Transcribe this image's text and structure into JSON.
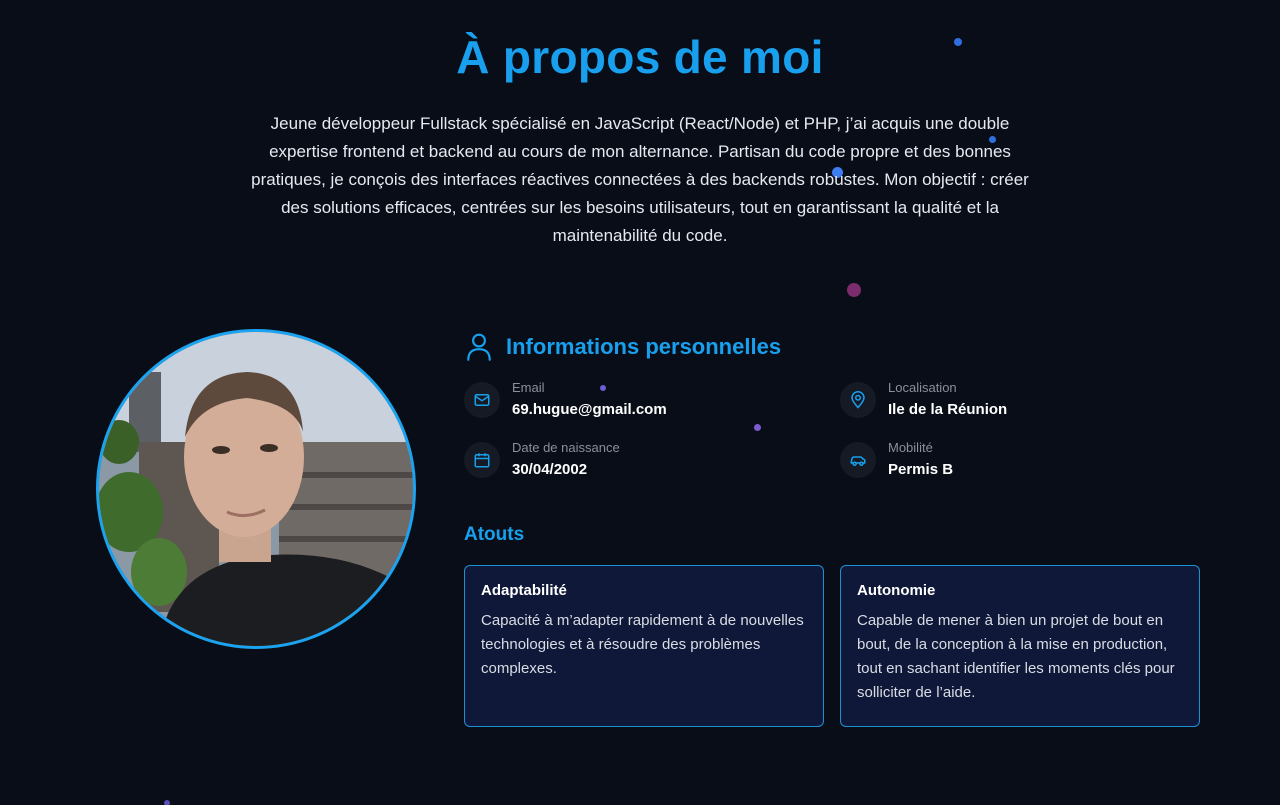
{
  "about": {
    "title": "À propos de moi",
    "intro": "Jeune développeur Fullstack spécialisé en JavaScript (React/Node) et PHP, j’ai acquis une double expertise frontend et backend au cours de mon alternance. Partisan du code propre et des bonnes pratiques, je conçois des interfaces réactives connectées à des backends robustes. Mon objectif : créer des solutions efficaces, centrées sur les besoins utilisateurs, tout en garantissant la qualité et la maintenabilité du code."
  },
  "personal_info": {
    "title": "Informations personnelles",
    "title_icon": "user-icon",
    "items": [
      {
        "label": "Email",
        "value": "69.hugue@gmail.com",
        "icon": "mail-icon"
      },
      {
        "label": "Localisation",
        "value": "Ile de la Réunion",
        "icon": "map-pin-icon"
      },
      {
        "label": "Date de naissance",
        "value": "30/04/2002",
        "icon": "calendar-icon"
      },
      {
        "label": "Mobilité",
        "value": "Permis B",
        "icon": "car-icon"
      }
    ]
  },
  "atouts": {
    "title": "Atouts",
    "cards": [
      {
        "title": "Adaptabilité",
        "text": "Capacité à m’adapter rapidement à de nouvelles technologies et à résoudre des problèmes complexes."
      },
      {
        "title": "Autonomie",
        "text": "Capable de mener à bien un projet de bout en bout, de la conception à la mise en production, tout en sachant identifier les moments clés pour solliciter de l’aide."
      }
    ]
  },
  "colors": {
    "background": "#090d17",
    "accent": "#18a0ee",
    "card_background": "#0f1838",
    "card_border": "#1c8fd6"
  }
}
